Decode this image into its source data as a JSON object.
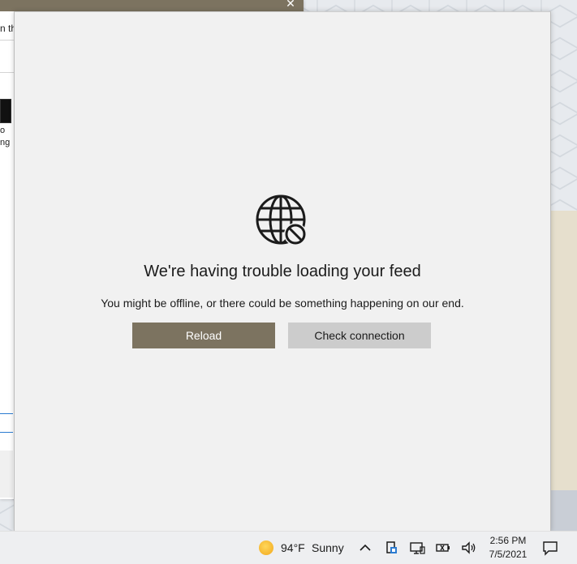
{
  "background_window": {
    "partial_text": "n th",
    "thumb_label_1": "o",
    "thumb_label_2": "ng"
  },
  "feed_error": {
    "title": "We're having trouble loading your feed",
    "message": "You might be offline, or there could be something happening on our end.",
    "icon": "globe-blocked-icon",
    "reload_label": "Reload",
    "check_connection_label": "Check connection"
  },
  "taskbar": {
    "weather": {
      "icon": "sun-icon",
      "temperature": "94°F",
      "condition": "Sunny"
    },
    "tray_icons": [
      "chevron-up-icon",
      "tray-app-icon",
      "network-icon",
      "battery-icon",
      "volume-icon"
    ],
    "clock": {
      "time": "2:56 PM",
      "date": "7/5/2021"
    },
    "notification_icon": "notification-icon"
  },
  "colors": {
    "accent": "#7c7360",
    "secondary_button": "#cccccc",
    "panel_bg": "#f1f1f1"
  }
}
